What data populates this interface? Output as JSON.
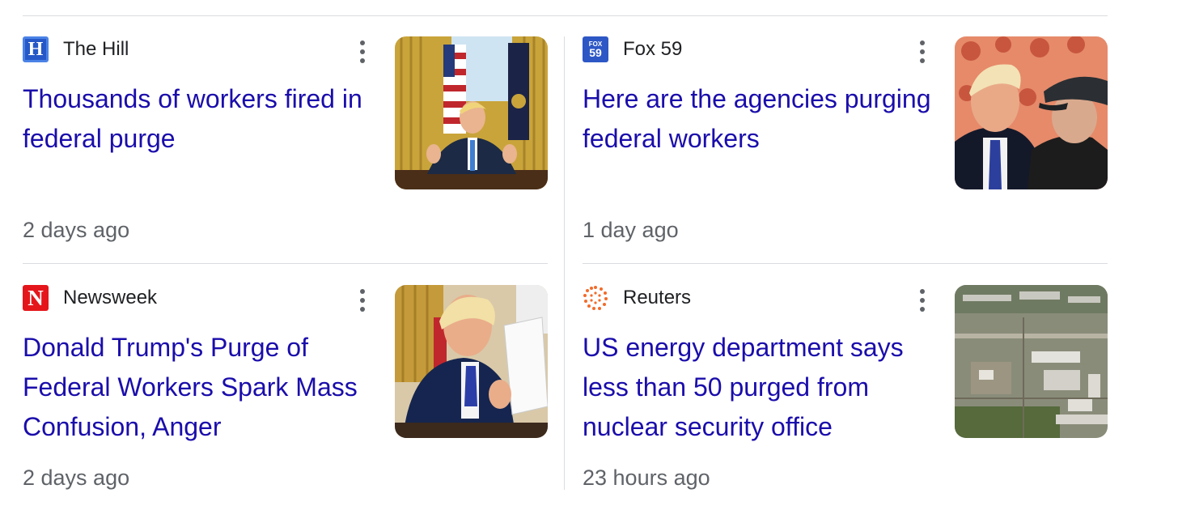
{
  "articles": [
    {
      "source": "The Hill",
      "logo_icon": "the-hill-logo",
      "logo_text": "H",
      "title": "Thousands of workers fired in federal purge",
      "time": "2 days ago",
      "thumbnail": "trump-oval-office-photo"
    },
    {
      "source": "Fox 59",
      "logo_icon": "fox59-logo",
      "logo_text_top": "FOX",
      "logo_text_bottom": "59",
      "title": "Here are the agencies purging federal workers",
      "time": "1 day ago",
      "thumbnail": "trump-musk-photo"
    },
    {
      "source": "Newsweek",
      "logo_icon": "newsweek-logo",
      "logo_text": "N",
      "title": "Donald Trump's Purge of Federal Workers Spark Mass Confusion, Anger",
      "time": "2 days ago",
      "thumbnail": "trump-signing-photo"
    },
    {
      "source": "Reuters",
      "logo_icon": "reuters-logo",
      "title": "US energy department says less than 50 purged from nuclear security office",
      "time": "23 hours ago",
      "thumbnail": "nuclear-facility-aerial-photo"
    }
  ],
  "colors": {
    "title_link": "#1a0dab",
    "source_text": "#202124",
    "timestamp": "#5f6368",
    "divider": "#dadce0"
  }
}
